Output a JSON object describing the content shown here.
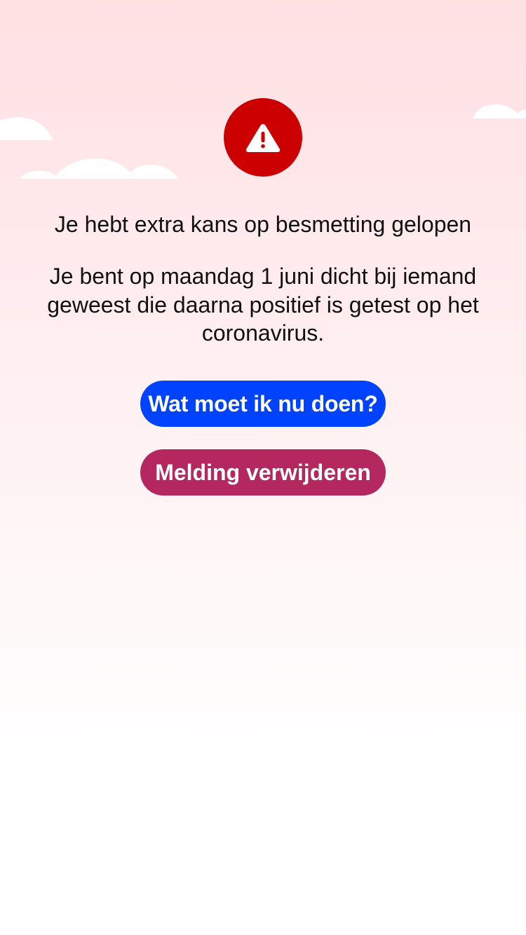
{
  "colors": {
    "alert_badge": "#cc0000",
    "primary_button": "#0043ff",
    "secondary_button": "#b5275f",
    "text": "#111111",
    "background_top": "#ffe0e3",
    "background_bottom": "#ffffff"
  },
  "icons": {
    "alert": "warning-triangle-icon",
    "decoration": "cloud-icon"
  },
  "notification": {
    "title": "Je hebt extra kans op besmetting gelopen",
    "message": "Je bent op maandag 1 juni dicht bij iemand geweest die daarna positief is getest op het coronavirus."
  },
  "actions": {
    "primary_label": "Wat moet ik nu doen?",
    "secondary_label": "Melding verwijderen"
  }
}
